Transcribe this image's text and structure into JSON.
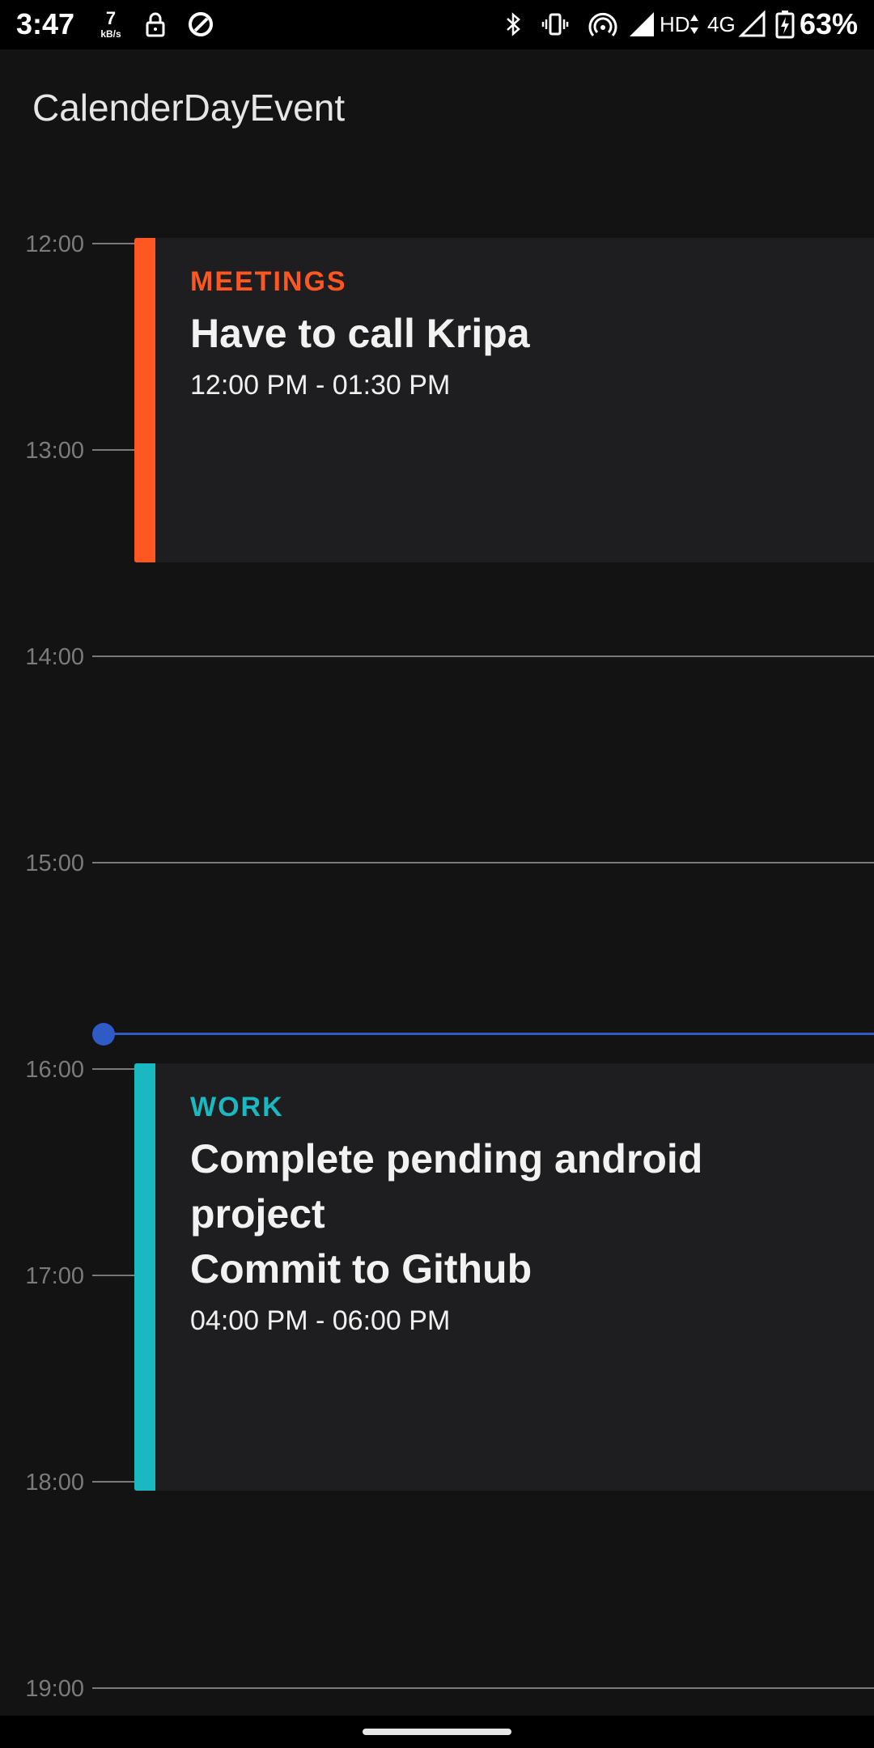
{
  "status_bar": {
    "time": "3:47",
    "speed_value": "7",
    "speed_unit": "kB/s",
    "network_hd": "HD",
    "network_type": "4G",
    "battery": "63%"
  },
  "app_bar": {
    "title": "CalenderDayEvent"
  },
  "timeline": {
    "hours": [
      "12:00",
      "13:00",
      "14:00",
      "15:00",
      "16:00",
      "17:00",
      "18:00",
      "19:00"
    ]
  },
  "events": [
    {
      "category": "MEETINGS",
      "title": "Have to call Kripa",
      "time": "12:00 PM - 01:30 PM",
      "color": "#ff5722"
    },
    {
      "category": "WORK",
      "title_lines": [
        "Complete pending android",
        "project",
        "Commit to Github"
      ],
      "time": "04:00 PM - 06:00 PM",
      "color": "#1ab8c0"
    }
  ],
  "colors": {
    "now_indicator": "#2f5bc7",
    "background": "#131314",
    "card": "#1e1e20"
  }
}
